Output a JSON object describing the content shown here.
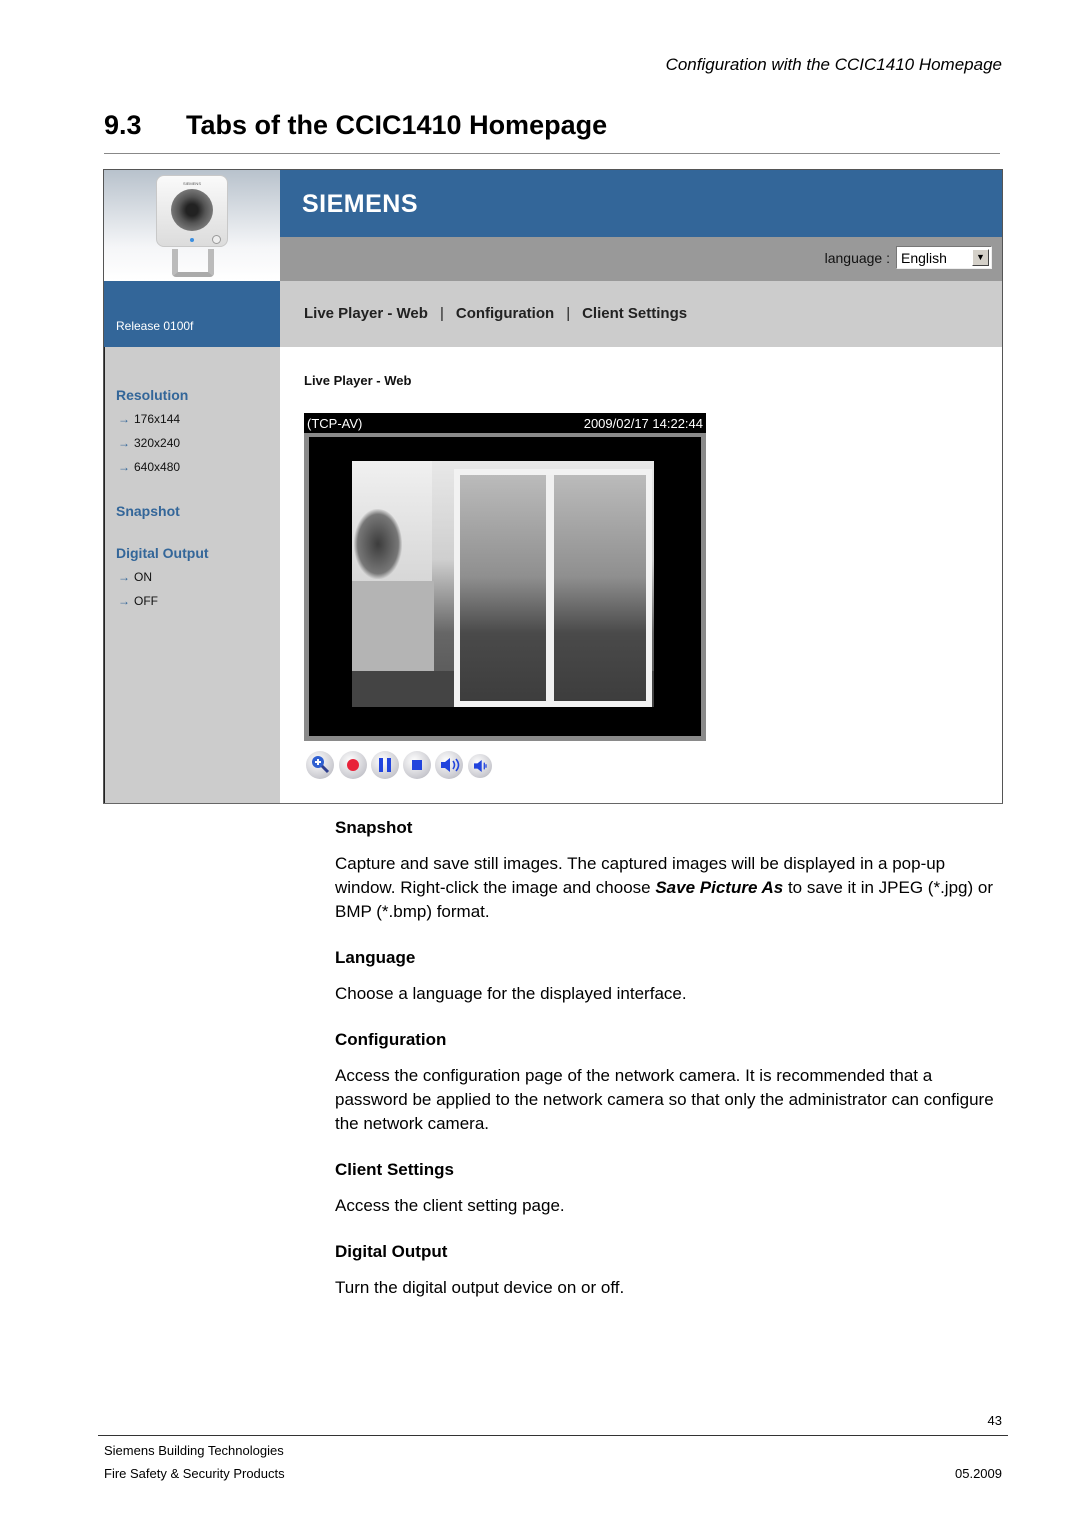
{
  "running_header": "Configuration with the CCIC1410 Homepage",
  "section": {
    "number": "9.3",
    "title": "Tabs of the CCIC1410 Homepage"
  },
  "screenshot": {
    "camera_brand": "SIEMENS",
    "brand_logo": "SIEMENS",
    "brand_color": "#336699",
    "language": {
      "label": "language :",
      "selected": "English"
    },
    "release": "Release 0100f",
    "nav": [
      {
        "label": "Live Player - Web"
      },
      {
        "label": "Configuration"
      },
      {
        "label": "Client Settings"
      }
    ],
    "nav_separator": "|",
    "sidebar": {
      "resolution": {
        "heading": "Resolution",
        "items": [
          "176x144",
          "320x240",
          "640x480"
        ]
      },
      "snapshot": {
        "heading": "Snapshot"
      },
      "digital_output": {
        "heading": "Digital Output",
        "items": [
          "ON",
          "OFF"
        ]
      },
      "arrow": "→"
    },
    "main_title": "Live Player - Web",
    "video": {
      "protocol": "(TCP-AV)",
      "timestamp": "2009/02/17 14:22:44"
    },
    "controls": [
      "zoom-in",
      "record",
      "pause",
      "stop",
      "speaker-volume",
      "microphone-volume"
    ]
  },
  "descriptions": [
    {
      "heading": "Snapshot",
      "text_before": "Capture and save still images. The captured images will be displayed in a pop-up window. Right-click the image and choose ",
      "emphasis": "Save Picture As",
      "text_after": " to save it in JPEG (*.jpg) or BMP (*.bmp) format."
    },
    {
      "heading": "Language",
      "text": "Choose a language for the displayed interface."
    },
    {
      "heading": "Configuration",
      "text": "Access the configuration page of the network camera. It is recommended that a password be applied to the network camera so that only the administrator can configure the network camera."
    },
    {
      "heading": "Client Settings",
      "text": "Access the client setting page."
    },
    {
      "heading": "Digital Output",
      "text": "Turn the digital output device on or off."
    }
  ],
  "footer": {
    "page_number": "43",
    "company": "Siemens Building Technologies",
    "division": "Fire Safety & Security Products",
    "date": "05.2009"
  }
}
